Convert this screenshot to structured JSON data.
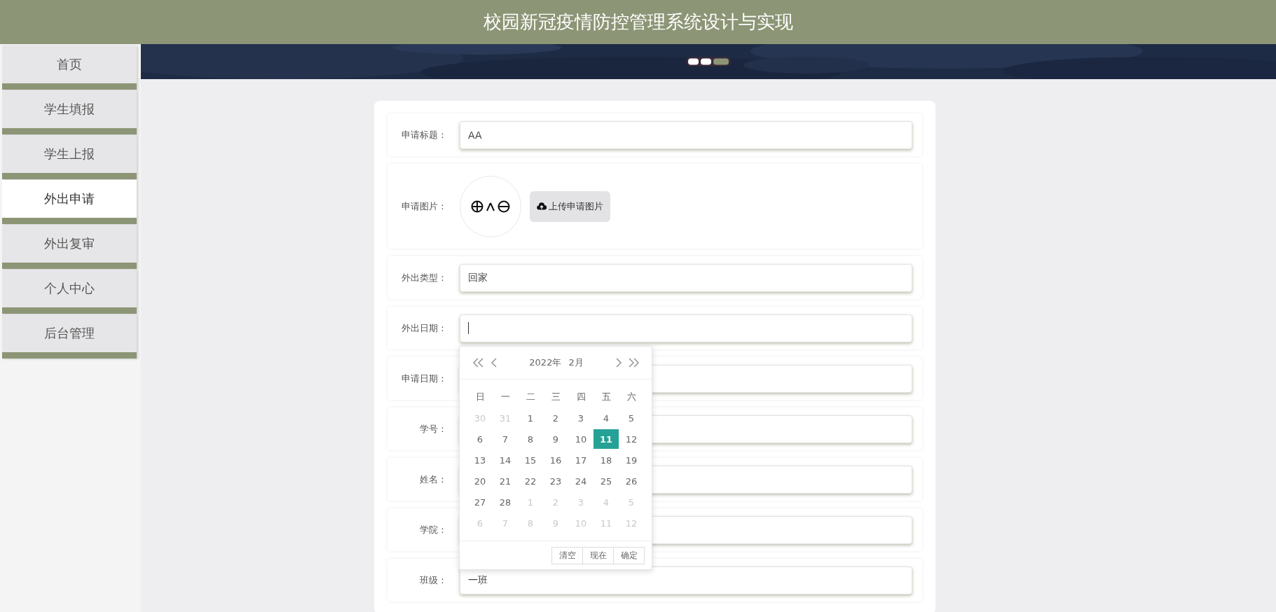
{
  "header": {
    "title": "校园新冠疫情防控管理系统设计与实现"
  },
  "sidebar": {
    "items": [
      {
        "label": "首页",
        "selected": false
      },
      {
        "label": "学生填报",
        "selected": false
      },
      {
        "label": "学生上报",
        "selected": false
      },
      {
        "label": "外出申请",
        "selected": true
      },
      {
        "label": "外出复审",
        "selected": false
      },
      {
        "label": "个人中心",
        "selected": false
      },
      {
        "label": "后台管理",
        "selected": false
      }
    ]
  },
  "banner": {
    "dots": [
      {
        "selected": false
      },
      {
        "selected": false
      },
      {
        "selected": true
      }
    ]
  },
  "form": {
    "fields": [
      {
        "kind": "text",
        "label": "申请标题：",
        "value": "AA"
      },
      {
        "label": "申请图片：",
        "button": "上传申请图片"
      },
      {
        "kind": "text",
        "label": "外出类型：",
        "value": "回家"
      },
      {
        "kind": "date",
        "label": "外出日期：",
        "focused": true
      },
      {
        "kind": "text",
        "label": "申请日期："
      },
      {
        "kind": "text",
        "label": "学号："
      },
      {
        "kind": "text",
        "label": "姓名："
      },
      {
        "kind": "text",
        "label": "学院："
      },
      {
        "kind": "text",
        "label": "班级：",
        "value": "一班"
      }
    ]
  },
  "date_picker": {
    "year": "2022年",
    "month": "2月",
    "weekdays": [
      "日",
      "一",
      "二",
      "三",
      "四",
      "五",
      "六"
    ],
    "days": [
      {
        "label": "30",
        "other_month": true,
        "selected": false
      },
      {
        "label": "31",
        "other_month": true,
        "selected": false
      },
      {
        "label": "1",
        "other_month": false,
        "selected": false
      },
      {
        "label": "2",
        "other_month": false,
        "selected": false
      },
      {
        "label": "3",
        "other_month": false,
        "selected": false
      },
      {
        "label": "4",
        "other_month": false,
        "selected": false
      },
      {
        "label": "5",
        "other_month": false,
        "selected": false
      },
      {
        "label": "6",
        "other_month": false,
        "selected": false
      },
      {
        "label": "7",
        "other_month": false,
        "selected": false
      },
      {
        "label": "8",
        "other_month": false,
        "selected": false
      },
      {
        "label": "9",
        "other_month": false,
        "selected": false
      },
      {
        "label": "10",
        "other_month": false,
        "selected": false
      },
      {
        "label": "11",
        "other_month": false,
        "selected": true
      },
      {
        "label": "12",
        "other_month": false,
        "selected": false
      },
      {
        "label": "13",
        "other_month": false,
        "selected": false
      },
      {
        "label": "14",
        "other_month": false,
        "selected": false
      },
      {
        "label": "15",
        "other_month": false,
        "selected": false
      },
      {
        "label": "16",
        "other_month": false,
        "selected": false
      },
      {
        "label": "17",
        "other_month": false,
        "selected": false
      },
      {
        "label": "18",
        "other_month": false,
        "selected": false
      },
      {
        "label": "19",
        "other_month": false,
        "selected": false
      },
      {
        "label": "20",
        "other_month": false,
        "selected": false
      },
      {
        "label": "21",
        "other_month": false,
        "selected": false
      },
      {
        "label": "22",
        "other_month": false,
        "selected": false
      },
      {
        "label": "23",
        "other_month": false,
        "selected": false
      },
      {
        "label": "24",
        "other_month": false,
        "selected": false
      },
      {
        "label": "25",
        "other_month": false,
        "selected": false
      },
      {
        "label": "26",
        "other_month": false,
        "selected": false
      },
      {
        "label": "27",
        "other_month": false,
        "selected": false
      },
      {
        "label": "28",
        "other_month": false,
        "selected": false
      },
      {
        "label": "1",
        "other_month": true,
        "selected": false
      },
      {
        "label": "2",
        "other_month": true,
        "selected": false
      },
      {
        "label": "3",
        "other_month": true,
        "selected": false
      },
      {
        "label": "4",
        "other_month": true,
        "selected": false
      },
      {
        "label": "5",
        "other_month": true,
        "selected": false
      },
      {
        "label": "6",
        "other_month": true,
        "selected": false
      },
      {
        "label": "7",
        "other_month": true,
        "selected": false
      },
      {
        "label": "8",
        "other_month": true,
        "selected": false
      },
      {
        "label": "9",
        "other_month": true,
        "selected": false
      },
      {
        "label": "10",
        "other_month": true,
        "selected": false
      },
      {
        "label": "11",
        "other_month": true,
        "selected": false
      },
      {
        "label": "12",
        "other_month": true,
        "selected": false
      }
    ],
    "buttons": [
      "清空",
      "现在",
      "确定"
    ]
  }
}
